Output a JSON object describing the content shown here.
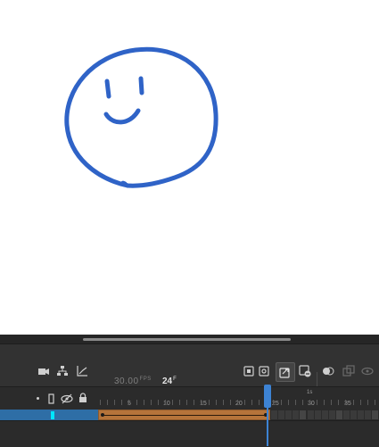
{
  "toolbar": {
    "fps_value": "30.00",
    "fps_unit": "FPS",
    "frame_value": "24",
    "frame_unit": "F"
  },
  "ruler": {
    "frame_numbers": [
      "5",
      "10",
      "15",
      "20",
      "25",
      "30",
      "35"
    ],
    "seconds_marker": "1s"
  },
  "layer": {
    "name": "",
    "swatch_color": "#00e5ff",
    "row_color": "#2e6ea6"
  },
  "colors": {
    "drawing_stroke": "#2f63c7",
    "span_fill": "#b5743a",
    "playhead": "#3d83d4"
  }
}
